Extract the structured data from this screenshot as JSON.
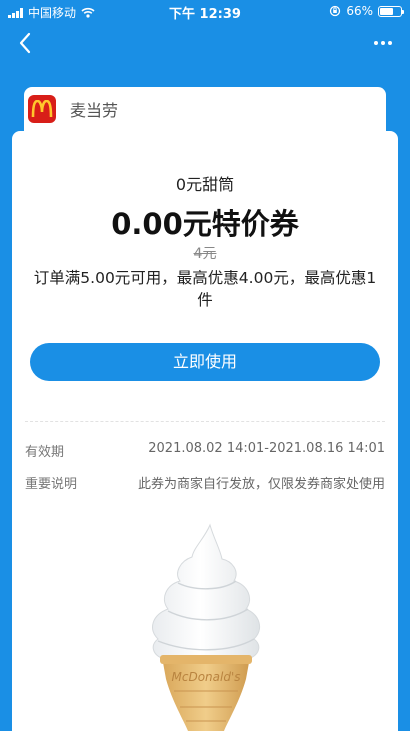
{
  "status_bar": {
    "carrier": "中国移动",
    "time": "下午 12:39",
    "battery_text": "66%",
    "battery_level": 0.66
  },
  "merchant": {
    "name": "麦当劳",
    "brand_color": "#d81e18",
    "logo_color": "#ffc72c"
  },
  "coupon": {
    "name": "0元甜筒",
    "price": "0.00元特价券",
    "original_price": "4元",
    "description": "订单满5.00元可用，最高优惠4.00元，最高优惠1件",
    "use_button": "立即使用"
  },
  "details": {
    "validity_label": "有效期",
    "validity_value": "2021.08.02 14:01-2021.08.16 14:01",
    "note_label": "重要说明",
    "note_value": "此券为商家自行发放，仅限发券商家处使用"
  },
  "image_text": "McDonald's",
  "colors": {
    "accent": "#1a8fe5",
    "card": "#ffffff"
  }
}
